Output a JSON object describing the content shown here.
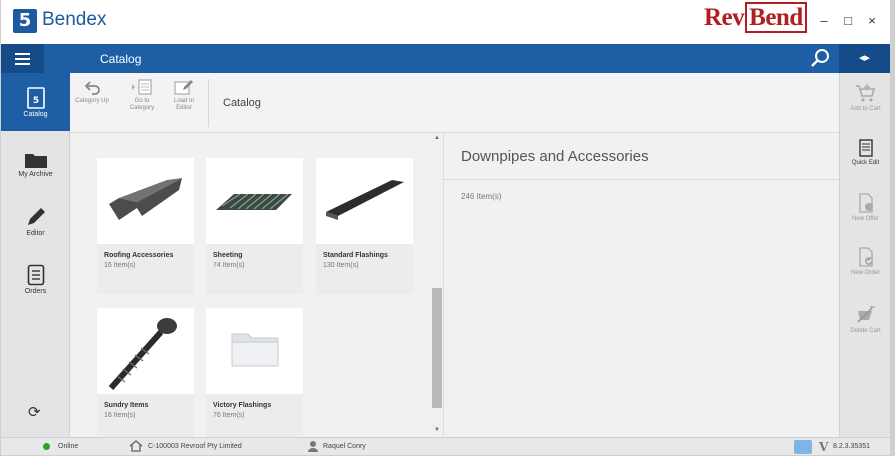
{
  "app": {
    "name": "Bendex",
    "logo_glyph": "5",
    "brand": {
      "rev": "Rev",
      "bend": "Bend"
    }
  },
  "window": {
    "minimize": "–",
    "maximize": "□",
    "close": "×"
  },
  "nav": {
    "title": "Catalog",
    "split_glyph": "◂▸"
  },
  "sidebar": {
    "items": [
      {
        "label": "Catalog",
        "icon": "catalog-book-icon"
      },
      {
        "label": "My Archive",
        "icon": "folder-icon"
      },
      {
        "label": "Editor",
        "icon": "pencil-icon"
      },
      {
        "label": "Orders",
        "icon": "orders-list-icon"
      }
    ],
    "refresh_glyph": "⟳"
  },
  "toolbar": {
    "category_up": "Category Up",
    "go_to_category": "Go to Category",
    "load_in_editor": "Load In Editor",
    "breadcrumb": "Catalog"
  },
  "catalog": {
    "cards": [
      {
        "name": "Roofing Accessories",
        "count": "16 Item(s)"
      },
      {
        "name": "Sheeting",
        "count": "74 Item(s)"
      },
      {
        "name": "Standard Flashings",
        "count": "130 Item(s)"
      },
      {
        "name": "Sundry Items",
        "count": "16 Item(s)"
      },
      {
        "name": "Victory Flashings",
        "count": "76 Item(s)"
      }
    ]
  },
  "scroll": {
    "up": "▲",
    "down": "▼"
  },
  "detail": {
    "title": "Downpipes and Accessories",
    "count": "246 Item(s)"
  },
  "actions": {
    "add_to_cart": "Add to Cart",
    "quick_edit": "Quick Edit",
    "new_offer": "New Offer",
    "new_order": "New Order",
    "delete_cart": "Delete Cart"
  },
  "status": {
    "connection": "Online",
    "customer": "C-100003 Revroof Pty Limited",
    "user": "Raquel Conry",
    "version_mark": "V",
    "version": "8.2.3.35351"
  },
  "colors": {
    "primary": "#1d5ea5",
    "brand_red": "#b21d1d",
    "online": "#2ca32c"
  }
}
